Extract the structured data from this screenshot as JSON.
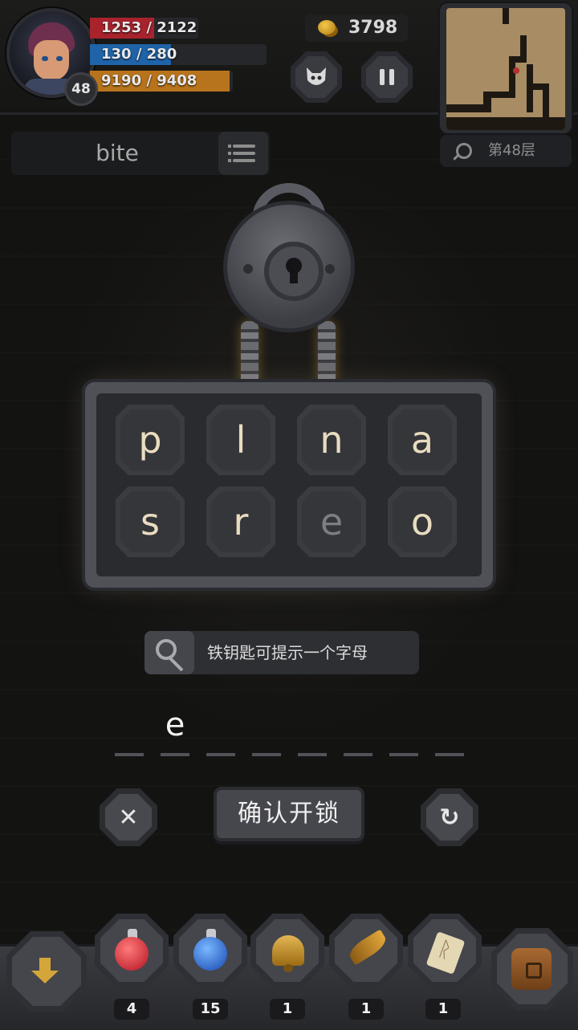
{
  "player": {
    "level": "48",
    "hp": "1253 / 2122",
    "mp": "130 / 280",
    "xp": "9190 / 9408",
    "hp_fraction": 0.59,
    "mp_fraction": 0.46,
    "xp_fraction": 0.98
  },
  "gold": "3798",
  "minimap": {
    "floor_label": "第48层"
  },
  "word_hint": {
    "word": "bite"
  },
  "letters": [
    {
      "char": "p",
      "used": false
    },
    {
      "char": "l",
      "used": false
    },
    {
      "char": "n",
      "used": false
    },
    {
      "char": "a",
      "used": false
    },
    {
      "char": "s",
      "used": false
    },
    {
      "char": "r",
      "used": false
    },
    {
      "char": "e",
      "used": true
    },
    {
      "char": "o",
      "used": false
    }
  ],
  "hint": {
    "text": "铁钥匙可提示一个字母",
    "icon": "key-icon"
  },
  "answer": {
    "slots": [
      "e",
      "",
      "",
      "",
      "",
      "",
      "",
      ""
    ]
  },
  "actions": {
    "clear_icon": "✕",
    "confirm_label": "确认开锁",
    "reset_icon": "↻"
  },
  "inventory": [
    {
      "item": "red-potion",
      "count": "4"
    },
    {
      "item": "blue-potion",
      "count": "15"
    },
    {
      "item": "bell",
      "count": "1"
    },
    {
      "item": "feather",
      "count": "1"
    },
    {
      "item": "rune-scroll",
      "count": "1"
    }
  ],
  "colors": {
    "hp": "#a8232c",
    "mp": "#1f63a8",
    "xp": "#b8741c",
    "letter": "#e9dcc0"
  }
}
